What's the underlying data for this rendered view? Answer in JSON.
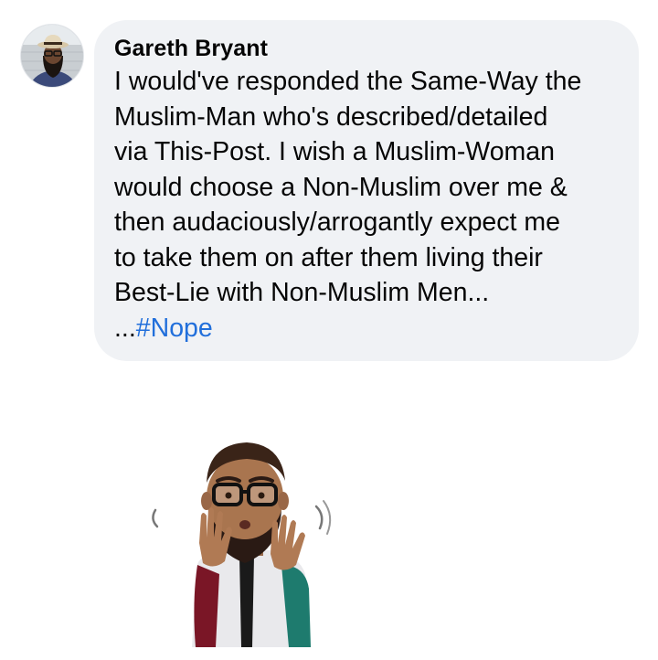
{
  "comment": {
    "author": "Gareth Bryant",
    "lines": [
      "I would've responded the Same-Way the",
      "Muslim-Man who's described/detailed",
      "via This-Post. I wish a Muslim-Woman",
      "would choose a Non-Muslim over me &",
      "then audaciously/arrogantly expect me",
      "to take them on after them living their",
      "Best-Lie with Non-Muslim Men..."
    ],
    "hashtag_prefix": "...",
    "hashtag": "#Nope"
  },
  "colors": {
    "bubble_background": "#f0f2f5",
    "text": "#050505",
    "link": "#216fdb"
  },
  "icons": {
    "avatar": "profile-photo-man-with-hat-and-beard",
    "sticker": "memoji-man-with-glasses-and-beard-waving-hands-no"
  }
}
